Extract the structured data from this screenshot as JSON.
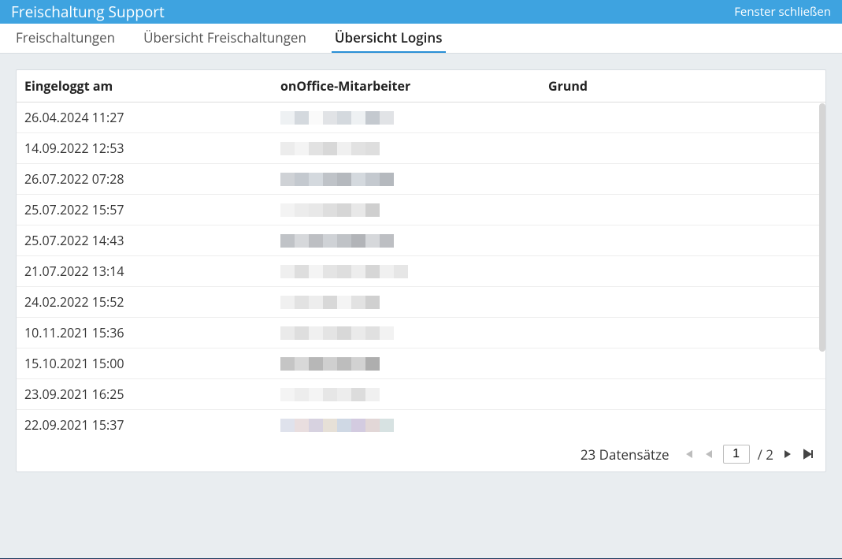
{
  "titlebar": {
    "title": "Freischaltung Support",
    "close": "Fenster schließen"
  },
  "tabs": [
    {
      "label": "Freischaltungen",
      "active": false
    },
    {
      "label": "Übersicht Freischaltungen",
      "active": false
    },
    {
      "label": "Übersicht Logins",
      "active": true
    }
  ],
  "table": {
    "headers": {
      "logged_in": "Eingeloggt am",
      "employee": "onOffice-Mitarbeiter",
      "reason": "Grund"
    },
    "rows": [
      {
        "date": "26.04.2024 11:27",
        "employee_redacted": true,
        "reason": ""
      },
      {
        "date": "14.09.2022 12:53",
        "employee_redacted": true,
        "reason": ""
      },
      {
        "date": "26.07.2022 07:28",
        "employee_redacted": true,
        "reason": ""
      },
      {
        "date": "25.07.2022 15:57",
        "employee_redacted": true,
        "reason": ""
      },
      {
        "date": "25.07.2022 14:43",
        "employee_redacted": true,
        "reason": ""
      },
      {
        "date": "21.07.2022 13:14",
        "employee_redacted": true,
        "reason": ""
      },
      {
        "date": "24.02.2022 15:52",
        "employee_redacted": true,
        "reason": ""
      },
      {
        "date": "10.11.2021 15:36",
        "employee_redacted": true,
        "reason": ""
      },
      {
        "date": "15.10.2021 15:00",
        "employee_redacted": true,
        "reason": ""
      },
      {
        "date": "23.09.2021 16:25",
        "employee_redacted": true,
        "reason": ""
      },
      {
        "date": "22.09.2021 15:37",
        "employee_redacted": true,
        "reason": ""
      }
    ]
  },
  "pager": {
    "count_label": "23 Datensätze",
    "page": "1",
    "total_prefix": "/",
    "total": "2"
  },
  "pixel_palettes": [
    [
      "#eef1f3",
      "#d4d9de",
      "#fafafa",
      "#e1e3e6",
      "#d4d9de",
      "#eef1f3",
      "#c4c9cf",
      "#e1e3e6"
    ],
    [
      "#ececec",
      "#f4f4f4",
      "#e2e2e2",
      "#d8d8d8",
      "#f0f0f0",
      "#e2e2e2",
      "#dedede"
    ],
    [
      "#cfd2d6",
      "#c4c9cf",
      "#d4d9de",
      "#bfc3c8",
      "#b5b9be",
      "#d4d9de",
      "#c4c9cf",
      "#b5b9be"
    ],
    [
      "#f3f3f3",
      "#ececec",
      "#e8e8e8",
      "#dedede",
      "#d6d6d6",
      "#e8e8e8",
      "#cfcfcf"
    ],
    [
      "#c0c3c7",
      "#d6d8db",
      "#bdbfc3",
      "#cfd2d6",
      "#c0c3c7",
      "#b2b4b8",
      "#d6d8db",
      "#bdbfc3"
    ],
    [
      "#efefef",
      "#dedede",
      "#f4f4f4",
      "#e4e4e4",
      "#dedede",
      "#ededed",
      "#d6d6d6",
      "#f0f0f0",
      "#e6e6e6"
    ],
    [
      "#f0f0f0",
      "#e2e2e2",
      "#ededed",
      "#d8d8d8",
      "#f4f4f4",
      "#e2e2e2",
      "#d0d0d0"
    ],
    [
      "#eaeaea",
      "#dedede",
      "#f0f0f0",
      "#e4e4e4",
      "#d8d8d8",
      "#eaeaea",
      "#e0e0e0",
      "#f2f2f2"
    ],
    [
      "#c5c5c5",
      "#d8d8d8",
      "#b7b7b7",
      "#cfcfcf",
      "#bdbdbd",
      "#d2d2d2",
      "#aeaeae"
    ],
    [
      "#f4f4f4",
      "#ededed",
      "#f4f4f4",
      "#e6e6e6",
      "#ededed",
      "#dcdcdc",
      "#f0f0f0"
    ],
    [
      "#dfe2ec",
      "#e9dedf",
      "#d7d2e0",
      "#e6e0d7",
      "#cfd8e4",
      "#d3cbe0",
      "#e2d7d7",
      "#d7e2e2"
    ]
  ]
}
